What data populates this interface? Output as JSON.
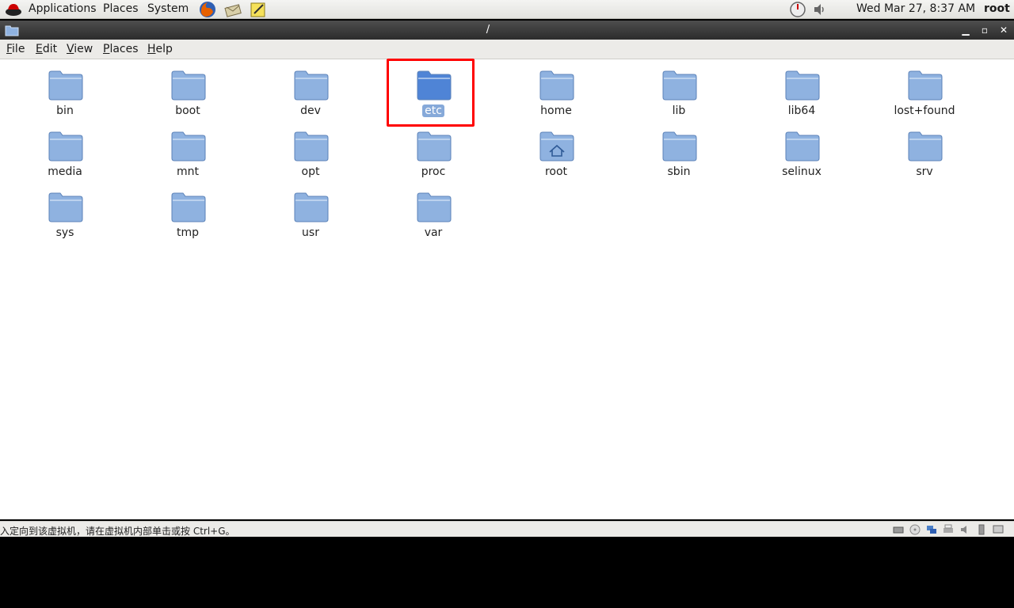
{
  "top_panel": {
    "menus": [
      "Applications",
      "Places",
      "System"
    ],
    "clock": "Wed Mar 27,  8:37 AM",
    "user": "root"
  },
  "window": {
    "title": "/"
  },
  "menubar": {
    "file": {
      "mnemonic": "F",
      "rest": "ile"
    },
    "edit": {
      "mnemonic": "E",
      "rest": "dit"
    },
    "view": {
      "mnemonic": "V",
      "rest": "iew"
    },
    "places": {
      "mnemonic": "P",
      "rest": "laces"
    },
    "help": {
      "mnemonic": "H",
      "rest": "elp"
    }
  },
  "folders": [
    {
      "name": "bin"
    },
    {
      "name": "boot"
    },
    {
      "name": "dev"
    },
    {
      "name": "etc",
      "selected": true
    },
    {
      "name": "home"
    },
    {
      "name": "lib"
    },
    {
      "name": "lib64"
    },
    {
      "name": "lost+found"
    },
    {
      "name": "media"
    },
    {
      "name": "mnt"
    },
    {
      "name": "opt"
    },
    {
      "name": "proc"
    },
    {
      "name": "root",
      "icon": "home-folder-icon"
    },
    {
      "name": "sbin"
    },
    {
      "name": "selinux"
    },
    {
      "name": "srv"
    },
    {
      "name": "sys"
    },
    {
      "name": "tmp"
    },
    {
      "name": "usr"
    },
    {
      "name": "var"
    }
  ],
  "status_bar": {
    "text": "入定向到该虚拟机，请在虚拟机内部单击或按 Ctrl+G。"
  },
  "colors": {
    "folder_fill": "#8fb2e0",
    "folder_selected": "#4f84d6",
    "highlight": "#ff0000"
  }
}
